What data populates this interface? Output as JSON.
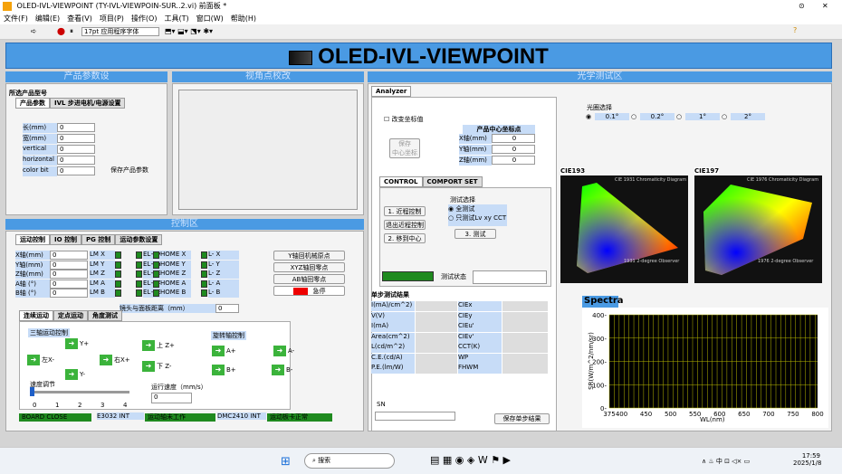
{
  "window": {
    "title": "OLED-IVL-VIEWPOINT (TY-IVL-VIEWPOIN-SUR..2.vi) 前面板 *",
    "pin": "⊙"
  },
  "menu": [
    "文件(F)",
    "编辑(E)",
    "查看(V)",
    "项目(P)",
    "操作(O)",
    "工具(T)",
    "窗口(W)",
    "帮助(H)"
  ],
  "toolbar": {
    "font": "17pt 应用程序字体"
  },
  "banner": {
    "title": "OLED-IVL-VIEWPOINT"
  },
  "sections": {
    "product": "产品参数设",
    "viewpoint": "视角点校改",
    "optical": "光学测试区",
    "control": "控制区",
    "spectra": "Spectra"
  },
  "product": {
    "model_label": "所选产品型号",
    "tabs": [
      "产品参数",
      "IVL 步进电机/电源设置"
    ],
    "fields": [
      {
        "label": "长(mm)",
        "value": "0"
      },
      {
        "label": "宽(mm)",
        "value": "0"
      },
      {
        "label": "vertical",
        "value": "0"
      },
      {
        "label": "horizontal",
        "value": "0"
      },
      {
        "label": "color bit",
        "value": "0"
      }
    ],
    "save": "保存产品参数"
  },
  "analyzer": {
    "tab": "Analyzer",
    "correct": "改变坐标值",
    "center_label": "产品中心坐标点",
    "save_center": "保存\n中心坐标",
    "axes": [
      {
        "label": "X轴(mm)",
        "value": "0"
      },
      {
        "label": "Y轴(mm)",
        "value": "0"
      },
      {
        "label": "Z轴(mm)",
        "value": "0"
      }
    ],
    "tabs": [
      "CONTROL",
      "COMPORT SET"
    ],
    "buttons": [
      "1. 近程控制",
      "退出近程控制",
      "2. 移到中心"
    ],
    "mode_title": "测试选择",
    "modes": [
      "全测试",
      "只测试Lv xy CCT"
    ],
    "test_btn": "3. 测试",
    "status_label": "测试状态",
    "single_label": "单步测试结果",
    "results_left": [
      "I(mA)/cm^2)",
      "V(V)",
      "I(mA)",
      "Area(cm^2)",
      "L(cd/m^2)",
      "C.E.(cd/A)",
      "P.E.(lm/W)"
    ],
    "results_right": [
      "CIEx",
      "CIEy",
      "CIEu'",
      "CIEv'",
      "CCT(K)",
      "WP",
      "FHWM"
    ],
    "sn_label": "SN",
    "save_single": "保存单步结果"
  },
  "aperture": {
    "label": "光圈选择",
    "options": [
      "0.1°",
      "0.2°",
      "1°",
      "2°"
    ]
  },
  "cie": [
    {
      "label": "CIE193",
      "caption": "CIE 1931 Chromaticity Diagram",
      "observer": "1931 2-degree Observer"
    },
    {
      "label": "CIE197",
      "caption": "CIE 1976 Chromaticity Diagram",
      "observer": "1976 2-degree Observer"
    }
  ],
  "control": {
    "tabs": [
      "运动控制",
      "IO 控制",
      "PG 控制",
      "运动参数设置"
    ],
    "axes": [
      {
        "label": "X轴(mm)",
        "value": "0"
      },
      {
        "label": "Y轴(mm)",
        "value": "0"
      },
      {
        "label": "Z轴(mm)",
        "value": "0"
      },
      {
        "label": "A轴 (°)",
        "value": "0"
      },
      {
        "label": "B轴 (°)",
        "value": "0"
      }
    ],
    "limits_c1": [
      "LM X",
      "LM Y",
      "LM Z",
      "LM A",
      "LM B"
    ],
    "limits_c2": [
      "EL+ X",
      "EL+ Y",
      "EL+ Z",
      "EL+ A",
      "EL+ B"
    ],
    "limits_c3": [
      "HOME X",
      "HOME Y",
      "HOME Z",
      "HOME A",
      "HOME B"
    ],
    "limits_c4": [
      "L- X",
      "L- Y",
      "L- Z",
      "L- A",
      "L- B"
    ],
    "right_btns": [
      "Y轴回机械原点",
      "XYZ轴回零点",
      "AB轴回零点",
      "急停"
    ],
    "dist_label": "镜头与面板距离（mm）",
    "dist_value": "0",
    "motion_tabs": [
      "连续运动",
      "定点运动",
      "角度测试"
    ],
    "three_axis": "三轴运动控制",
    "rot_axis": "旋转轴控制",
    "moves": [
      "Y+",
      "左X-",
      "右X+",
      "Y-",
      "上 Z+",
      "下 Z-",
      "A+",
      "A-",
      "B+",
      "B-"
    ],
    "speed_label": "速度调节",
    "speed_ticks": [
      "0",
      "1",
      "2",
      "3",
      "4"
    ],
    "run_speed_label": "运行速度（mm/s）",
    "run_speed_value": "0",
    "status": [
      "BOARD CLOSE",
      "E3032 INT",
      "运动轴未工作",
      "DMC2410 INT",
      "运动板卡正常"
    ]
  },
  "chart_data": {
    "type": "line",
    "title": "Spectra",
    "xlabel": "WL(nm)",
    "ylabel": "SR(W/m^2/nm/sr)",
    "xlim": [
      375,
      800
    ],
    "ylim": [
      0,
      400
    ],
    "xticks": [
      "375",
      "400",
      "450",
      "500",
      "550",
      "600",
      "650",
      "700",
      "750",
      "800"
    ],
    "yticks": [
      "0",
      "100",
      "200",
      "300",
      "400"
    ],
    "grid": true,
    "series": []
  },
  "taskbar": {
    "search": "搜索",
    "lang": "中",
    "time": "17:59",
    "date": "2025/1/8"
  }
}
